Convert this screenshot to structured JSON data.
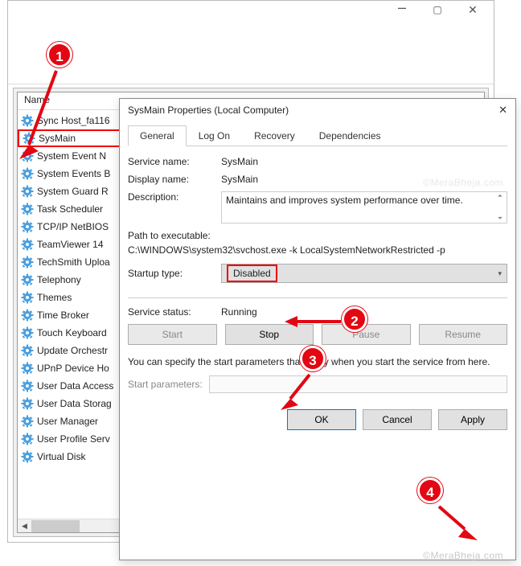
{
  "outer": {
    "header_name": "Name"
  },
  "services": [
    "Sync Host_fa116",
    "SysMain",
    "System Event N",
    "System Events B",
    "System Guard R",
    "Task Scheduler",
    "TCP/IP NetBIOS",
    "TeamViewer 14",
    "TechSmith Uploa",
    "Telephony",
    "Themes",
    "Time Broker",
    "Touch Keyboard",
    "Update Orchestr",
    "UPnP Device Ho",
    "User Data Access",
    "User Data Storag",
    "User Manager",
    "User Profile Serv",
    "Virtual Disk"
  ],
  "highlight_index": 1,
  "dialog": {
    "title": "SysMain Properties (Local Computer)",
    "tabs": [
      "General",
      "Log On",
      "Recovery",
      "Dependencies"
    ],
    "active_tab": 0,
    "labels": {
      "service_name": "Service name:",
      "display_name": "Display name:",
      "description": "Description:",
      "path_label": "Path to executable:",
      "startup_type": "Startup type:",
      "service_status": "Service status:",
      "hint": "You can specify the start parameters that apply when you start the service from here.",
      "start_params": "Start parameters:"
    },
    "values": {
      "service_name": "SysMain",
      "display_name": "SysMain",
      "description": "Maintains and improves system performance over time.",
      "path": "C:\\WINDOWS\\system32\\svchost.exe -k LocalSystemNetworkRestricted -p",
      "startup_type": "Disabled",
      "service_status": "Running",
      "start_params": ""
    },
    "buttons": {
      "start": "Start",
      "stop": "Stop",
      "pause": "Pause",
      "resume": "Resume",
      "ok": "OK",
      "cancel": "Cancel",
      "apply": "Apply"
    },
    "button_state": {
      "start": false,
      "stop": true,
      "pause": false,
      "resume": false
    }
  },
  "markers": [
    "1",
    "2",
    "3",
    "4"
  ],
  "watermark": "©MeraBheja.com"
}
